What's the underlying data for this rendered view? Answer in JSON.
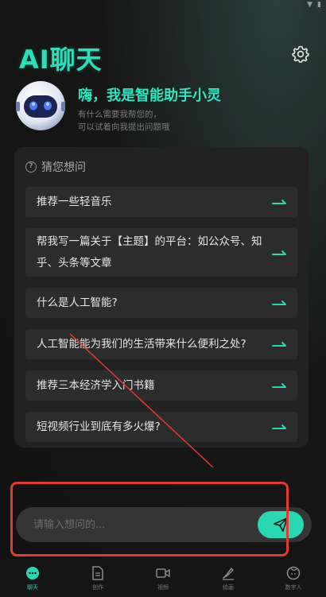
{
  "header": {
    "title": "AI聊天"
  },
  "hero": {
    "greeting": "嗨，我是智能助手小灵",
    "subtitle_line1": "有什么需要我帮您的，",
    "subtitle_line2": "可以试着向我提出问题哦"
  },
  "suggestions": {
    "title": "猜您想问",
    "items": [
      {
        "text": "推荐一些轻音乐"
      },
      {
        "text": "帮我写一篇关于【主题】的平台：如公众号、知乎、头条等文章"
      },
      {
        "text": "什么是人工智能?"
      },
      {
        "text": "人工智能能为我们的生活带来什么便利之处?"
      },
      {
        "text": "推荐三本经济学入门书籍"
      },
      {
        "text": "短视频行业到底有多火爆?"
      }
    ]
  },
  "input": {
    "placeholder": "请输入想问的..."
  },
  "tabs": [
    {
      "label": "聊天",
      "icon": "chat-icon",
      "active": true
    },
    {
      "label": "创作",
      "icon": "document-icon",
      "active": false
    },
    {
      "label": "视频",
      "icon": "video-icon",
      "active": false
    },
    {
      "label": "绘画",
      "icon": "brush-icon",
      "active": false
    },
    {
      "label": "数字人",
      "icon": "digital-human-icon",
      "active": false
    }
  ],
  "colors": {
    "accent": "#27d8b2",
    "annotation": "#e03a31",
    "panel": "#222222"
  }
}
